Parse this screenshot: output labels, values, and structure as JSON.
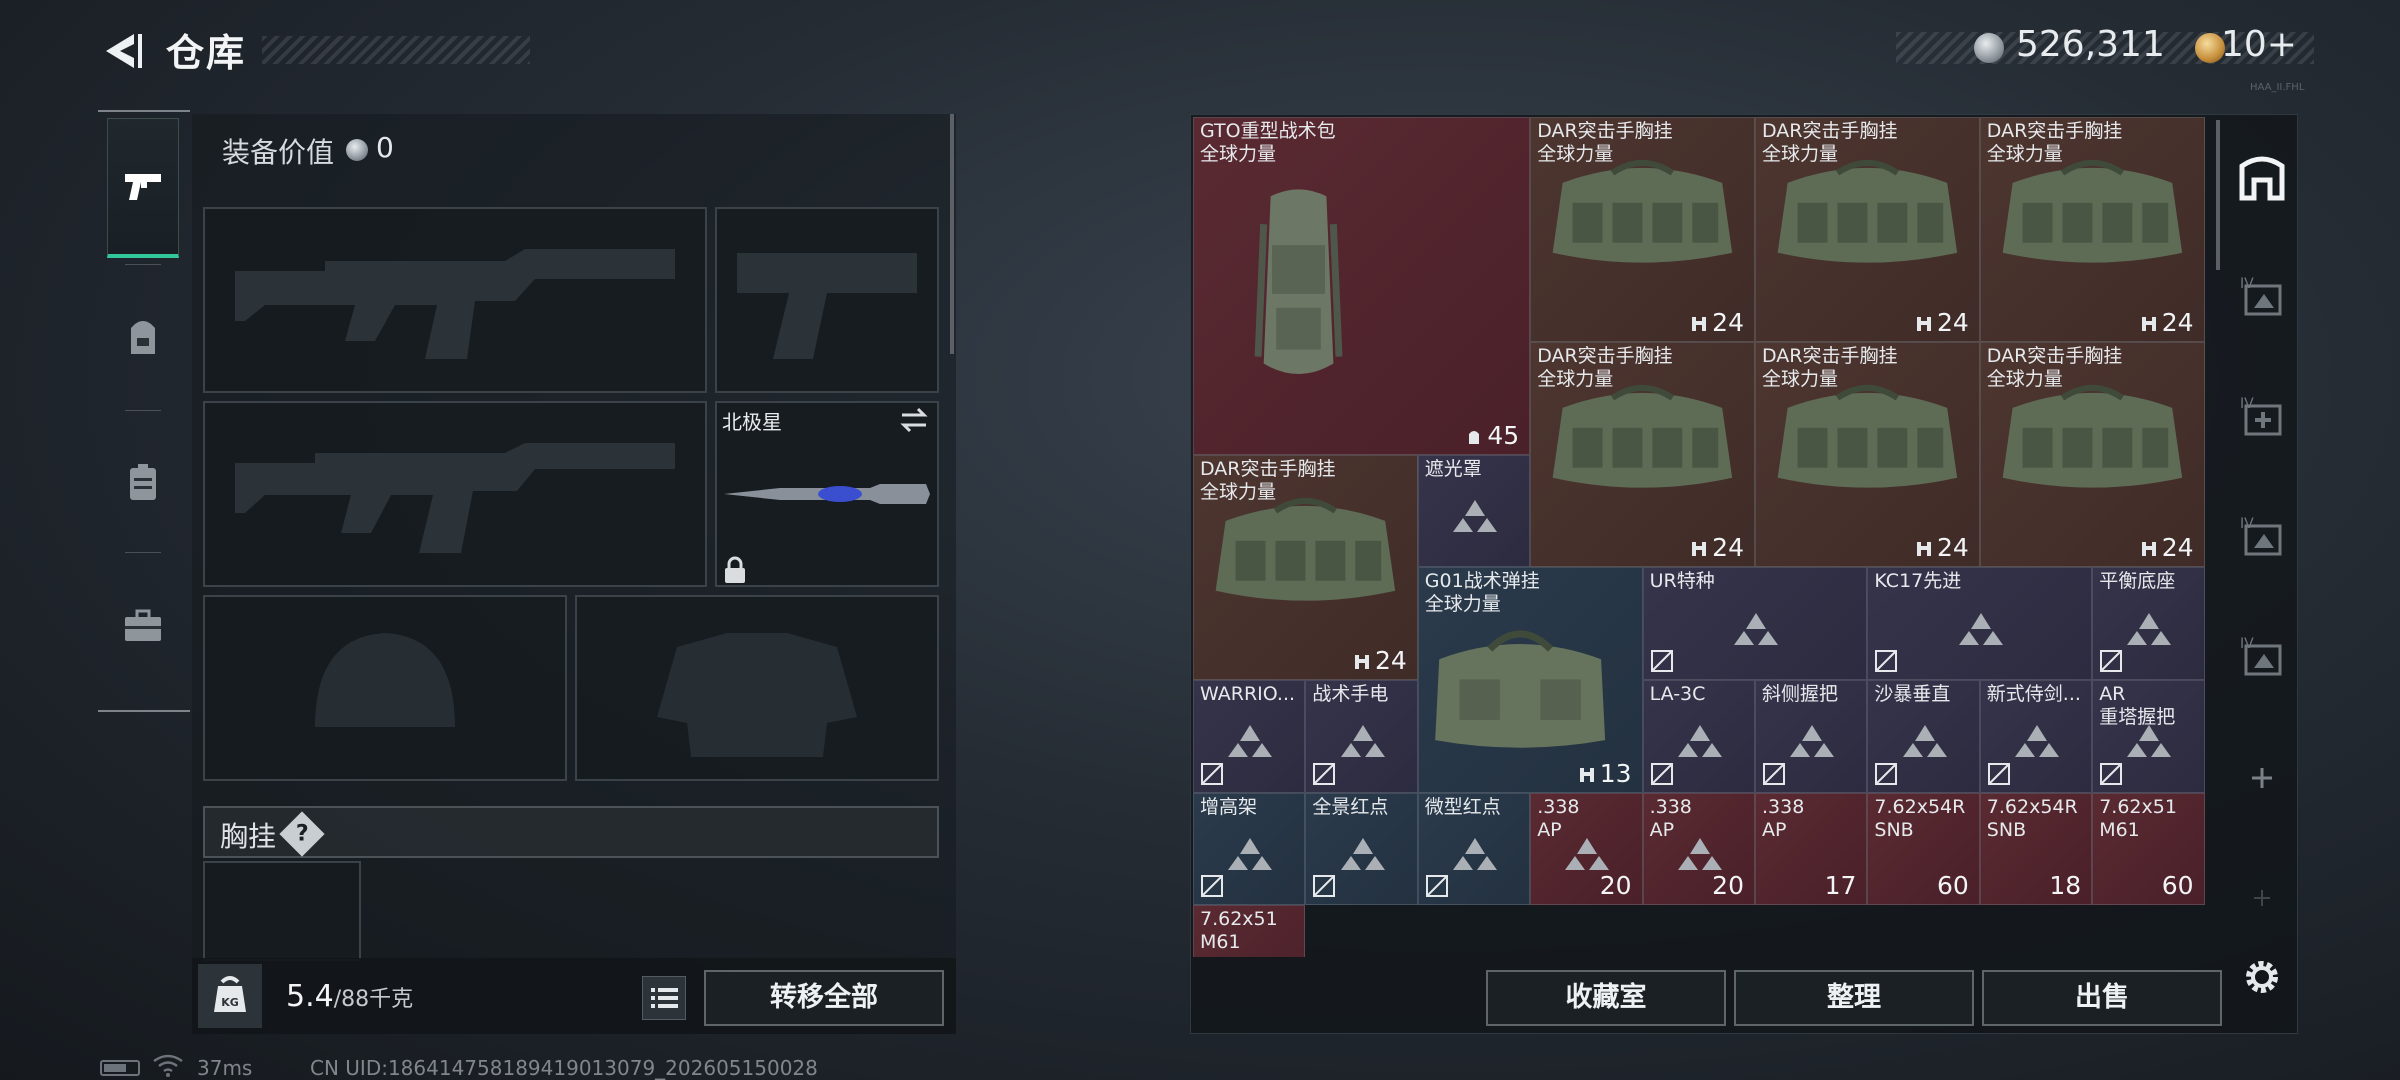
{
  "header": {
    "title": "仓库"
  },
  "currency": {
    "coin_value": "526,311",
    "premium_value": "10+"
  },
  "left_tabs": [
    "weapons",
    "backpack",
    "chest-rig",
    "case"
  ],
  "equipment": {
    "value_label": "装备价值",
    "value": "0",
    "melee_name": "北极星",
    "chest_label": "胸挂",
    "chest_help": "?"
  },
  "weight": {
    "current": "5.4",
    "max_unit": "/88千克"
  },
  "buttons": {
    "transfer_all": "转移全部",
    "collection": "收藏室",
    "sort": "整理",
    "sell": "出售"
  },
  "status": {
    "ping": "37ms",
    "uid": "CN UID:186414758189419013079_202605150028"
  },
  "watermark_small": "HAA_II.FHL",
  "grid_items": [
    {
      "name": "GTO重型战术包",
      "sub": "全球力量",
      "count": "45",
      "color": "red"
    },
    {
      "name": "DAR突击手胸挂",
      "sub": "全球力量",
      "count": "24",
      "color": "brn"
    },
    {
      "name": "DAR突击手胸挂",
      "sub": "全球力量",
      "count": "24",
      "color": "brn"
    },
    {
      "name": "DAR突击手胸挂",
      "sub": "全球力量",
      "count": "24",
      "color": "brn"
    },
    {
      "name": "DAR突击手胸挂",
      "sub": "全球力量",
      "count": "24",
      "color": "brn"
    },
    {
      "name": "DAR突击手胸挂",
      "sub": "全球力量",
      "count": "24",
      "color": "brn"
    },
    {
      "name": "DAR突击手胸挂",
      "sub": "全球力量",
      "count": "24",
      "color": "brn"
    },
    {
      "name": "DAR突击手胸挂",
      "sub": "全球力量",
      "count": "24",
      "color": "brn"
    },
    {
      "name": "遮光罩",
      "sub": "",
      "count": "",
      "color": "pur"
    },
    {
      "name": "G01战术弹挂",
      "sub": "全球力量",
      "count": "13",
      "color": "blu"
    },
    {
      "name": "UR特种",
      "sub": "",
      "count": "",
      "color": "pur"
    },
    {
      "name": "KC17先进",
      "sub": "",
      "count": "",
      "color": "pur"
    },
    {
      "name": "平衡底座",
      "sub": "",
      "count": "",
      "color": "pur"
    },
    {
      "name": "WARRIO...",
      "sub": "",
      "count": "",
      "color": "pur"
    },
    {
      "name": "战术手电",
      "sub": "",
      "count": "",
      "color": "pur"
    },
    {
      "name": "LA-3C",
      "sub": "",
      "count": "",
      "color": "pur"
    },
    {
      "name": "斜侧握把",
      "sub": "",
      "count": "",
      "color": "pur"
    },
    {
      "name": "沙暴垂直",
      "sub": "",
      "count": "",
      "color": "pur"
    },
    {
      "name": "新式侍剑...",
      "sub": "",
      "count": "",
      "color": "pur"
    },
    {
      "name": "AR",
      "sub": "重塔握把",
      "count": "",
      "color": "pur"
    },
    {
      "name": "增高架",
      "sub": "",
      "count": "",
      "color": "blu"
    },
    {
      "name": "全景红点",
      "sub": "",
      "count": "",
      "color": "blu"
    },
    {
      "name": "微型红点",
      "sub": "",
      "count": "",
      "color": "blu"
    },
    {
      "name": ".338",
      "sub": "AP",
      "count": "20",
      "color": "red"
    },
    {
      "name": ".338",
      "sub": "AP",
      "count": "20",
      "color": "red"
    },
    {
      "name": ".338",
      "sub": "AP",
      "count": "17",
      "color": "red"
    },
    {
      "name": "7.62x54R",
      "sub": "SNB",
      "count": "60",
      "color": "red"
    },
    {
      "name": "7.62x54R",
      "sub": "SNB",
      "count": "18",
      "color": "red"
    },
    {
      "name": "7.62x51",
      "sub": "M61",
      "count": "60",
      "color": "red"
    },
    {
      "name": "7.62x51",
      "sub": "M61",
      "count": "",
      "color": "red"
    }
  ]
}
